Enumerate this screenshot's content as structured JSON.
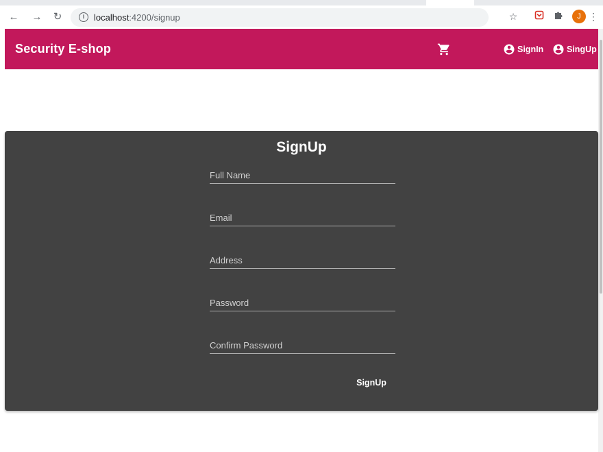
{
  "browser": {
    "url_host": "localhost",
    "url_path": ":4200/signup",
    "avatar_letter": "J"
  },
  "toolbar": {
    "brand": "Security E-shop",
    "signin_label": "SignIn",
    "signup_label": "SingUp",
    "color": "#c2185b"
  },
  "form": {
    "title": "SignUp",
    "fields": [
      {
        "placeholder": "Full Name",
        "value": ""
      },
      {
        "placeholder": "Email",
        "value": ""
      },
      {
        "placeholder": "Address",
        "value": ""
      },
      {
        "placeholder": "Password",
        "value": ""
      },
      {
        "placeholder": "Confirm Password",
        "value": ""
      }
    ],
    "submit_label": "SignUp",
    "card_color": "#424242"
  },
  "icons": {
    "back": "arrow-left-icon",
    "forward": "arrow-right-icon",
    "reload": "reload-icon",
    "info": "info-icon",
    "star": "star-icon",
    "pocket": "pocket-icon",
    "extensions": "puzzle-icon",
    "menu": "kebab-menu-icon",
    "cart": "shopping-cart-icon",
    "account": "account-circle-icon"
  }
}
